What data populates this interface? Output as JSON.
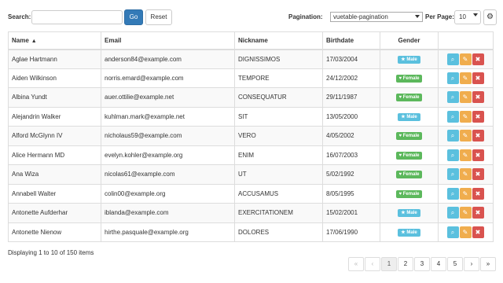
{
  "toolbar": {
    "search_label": "Search:",
    "search_placeholder": "",
    "go_label": "Go",
    "reset_label": "Reset",
    "pagination_label": "Pagination:",
    "pagination_value": "vuetable-pagination",
    "per_page_label": "Per Page:",
    "per_page_value": "10",
    "settings_icon": "gear-icon"
  },
  "table": {
    "headers": {
      "name": "Name",
      "email": "Email",
      "nickname": "Nickname",
      "birthdate": "Birthdate",
      "gender": "Gender",
      "actions": ""
    },
    "sort_icon": "caret-up-icon",
    "rows": [
      {
        "name": "Aglae Hartmann",
        "email": "anderson84@example.com",
        "nickname": "DIGNISSIMOS",
        "birthdate": "17/03/2004",
        "gender": "Male",
        "gender_icon": "★"
      },
      {
        "name": "Aiden Wilkinson",
        "email": "norris.emard@example.com",
        "nickname": "TEMPORE",
        "birthdate": "24/12/2002",
        "gender": "Female",
        "gender_icon": "♥"
      },
      {
        "name": "Albina Yundt",
        "email": "auer.ottilie@example.net",
        "nickname": "CONSEQUATUR",
        "birthdate": "29/11/1987",
        "gender": "Female",
        "gender_icon": "♥"
      },
      {
        "name": "Alejandrin Walker",
        "email": "kuhlman.mark@example.net",
        "nickname": "SIT",
        "birthdate": "13/05/2000",
        "gender": "Male",
        "gender_icon": "★"
      },
      {
        "name": "Alford McGlynn IV",
        "email": "nicholaus59@example.com",
        "nickname": "VERO",
        "birthdate": "4/05/2002",
        "gender": "Female",
        "gender_icon": "♥"
      },
      {
        "name": "Alice Hermann MD",
        "email": "evelyn.kohler@example.org",
        "nickname": "ENIM",
        "birthdate": "16/07/2003",
        "gender": "Female",
        "gender_icon": "♥"
      },
      {
        "name": "Ana Wiza",
        "email": "nicolas61@example.com",
        "nickname": "UT",
        "birthdate": "5/02/1992",
        "gender": "Female",
        "gender_icon": "♥"
      },
      {
        "name": "Annabell Walter",
        "email": "colin00@example.org",
        "nickname": "ACCUSAMUS",
        "birthdate": "8/05/1995",
        "gender": "Female",
        "gender_icon": "♥"
      },
      {
        "name": "Antonette Aufderhar",
        "email": "iblanda@example.com",
        "nickname": "EXERCITATIONEM",
        "birthdate": "15/02/2001",
        "gender": "Male",
        "gender_icon": "★"
      },
      {
        "name": "Antonette Nienow",
        "email": "hirthe.pasquale@example.org",
        "nickname": "DOLORES",
        "birthdate": "17/06/1990",
        "gender": "Male",
        "gender_icon": "★"
      }
    ],
    "action_icons": {
      "view": "⌕",
      "edit": "✎",
      "delete": "✖"
    }
  },
  "footer": {
    "info": "Displaying 1 to 10 of 150 items",
    "pager": {
      "first": "«",
      "prev": "‹",
      "pages": [
        "1",
        "2",
        "3",
        "4",
        "5"
      ],
      "active_page": "1",
      "next": "›",
      "last": "»"
    }
  },
  "colors": {
    "primary": "#337ab7",
    "male_badge": "#5bc0de",
    "female_badge": "#5cb85c",
    "view_btn": "#5bc0de",
    "edit_btn": "#f0ad4e",
    "delete_btn": "#d9534f"
  }
}
